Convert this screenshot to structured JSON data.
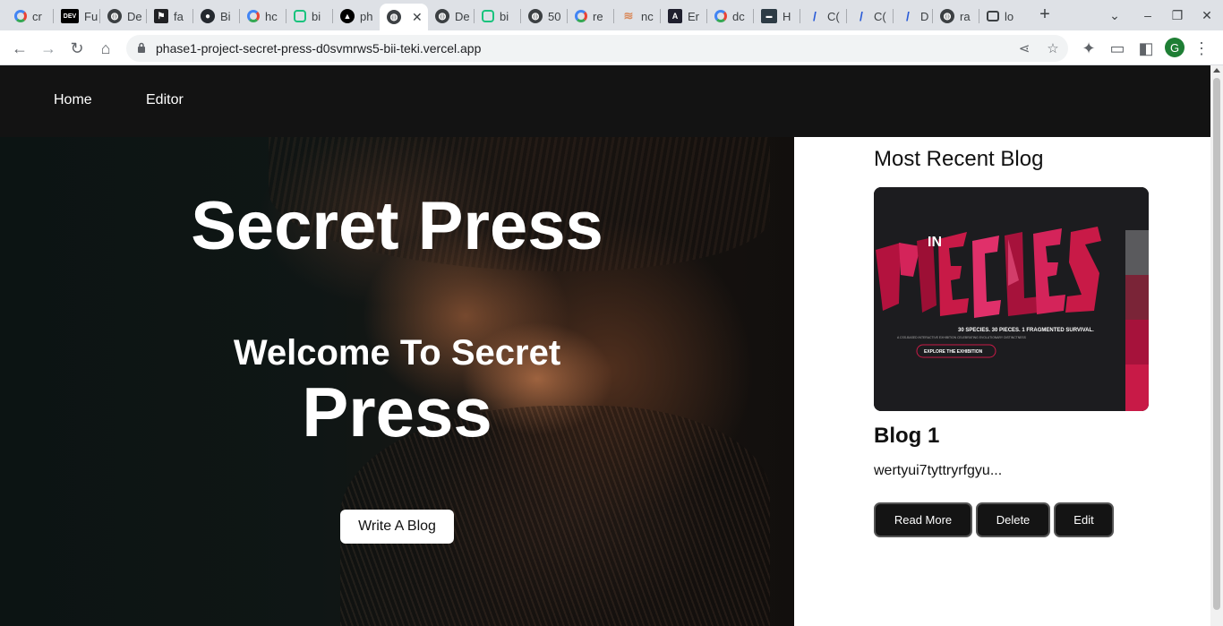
{
  "browser": {
    "tabs": [
      {
        "title": "cr",
        "icon": "google-icon"
      },
      {
        "title": "Fu",
        "icon": "dev-icon"
      },
      {
        "title": "De",
        "icon": "globe-icon"
      },
      {
        "title": "fa",
        "icon": "flag-icon"
      },
      {
        "title": "Bi",
        "icon": "github-icon"
      },
      {
        "title": "hc",
        "icon": "google-icon"
      },
      {
        "title": "bi",
        "icon": "chatgpt-icon"
      },
      {
        "title": "ph",
        "icon": "vercel-icon"
      },
      {
        "title": "",
        "icon": "globe-icon",
        "active": true
      },
      {
        "title": "De",
        "icon": "globe-icon"
      },
      {
        "title": "bi",
        "icon": "chatgpt-icon"
      },
      {
        "title": "50",
        "icon": "globe-icon"
      },
      {
        "title": "re",
        "icon": "google-icon"
      },
      {
        "title": "nc",
        "icon": "netlify-icon"
      },
      {
        "title": "Er",
        "icon": "angular-icon"
      },
      {
        "title": "dc",
        "icon": "google-icon"
      },
      {
        "title": "H",
        "icon": "hd-icon"
      },
      {
        "title": "C(",
        "icon": "blue-slash-icon"
      },
      {
        "title": "C(",
        "icon": "blue-slash-icon"
      },
      {
        "title": "D",
        "icon": "blue-slash-icon"
      },
      {
        "title": "ra",
        "icon": "globe-icon"
      },
      {
        "title": "lo",
        "icon": "robot-icon"
      }
    ],
    "url": "phase1-project-secret-press-d0svmrws5-bii-teki.vercel.app",
    "profile_initial": "G"
  },
  "nav": {
    "home": "Home",
    "editor": "Editor"
  },
  "hero": {
    "title": "Secret Press",
    "welcome": "Welcome To Secret",
    "press": "Press",
    "cta": "Write A Blog"
  },
  "recent": {
    "heading": "Most Recent Blog",
    "image": {
      "logo_top": "IN",
      "logo_main": "PIECES",
      "tagline": "30 SPECIES. 30 PIECES. 1 FRAGMENTED SURVIVAL.",
      "subtagline": "A CSS-BASED INTERACTIVE EXHIBITION CELEBRATING EVOLUTIONARY DISTINCTNESS",
      "button": "EXPLORE THE EXHIBITION",
      "side_colors": [
        "#1c1c1f",
        "#5a5a5d",
        "#7a2437",
        "#a6123b",
        "#c81a47"
      ]
    },
    "title": "Blog 1",
    "excerpt": "wertyui7tyttryrfgyu...",
    "buttons": {
      "read_more": "Read More",
      "delete": "Delete",
      "edit": "Edit"
    }
  }
}
